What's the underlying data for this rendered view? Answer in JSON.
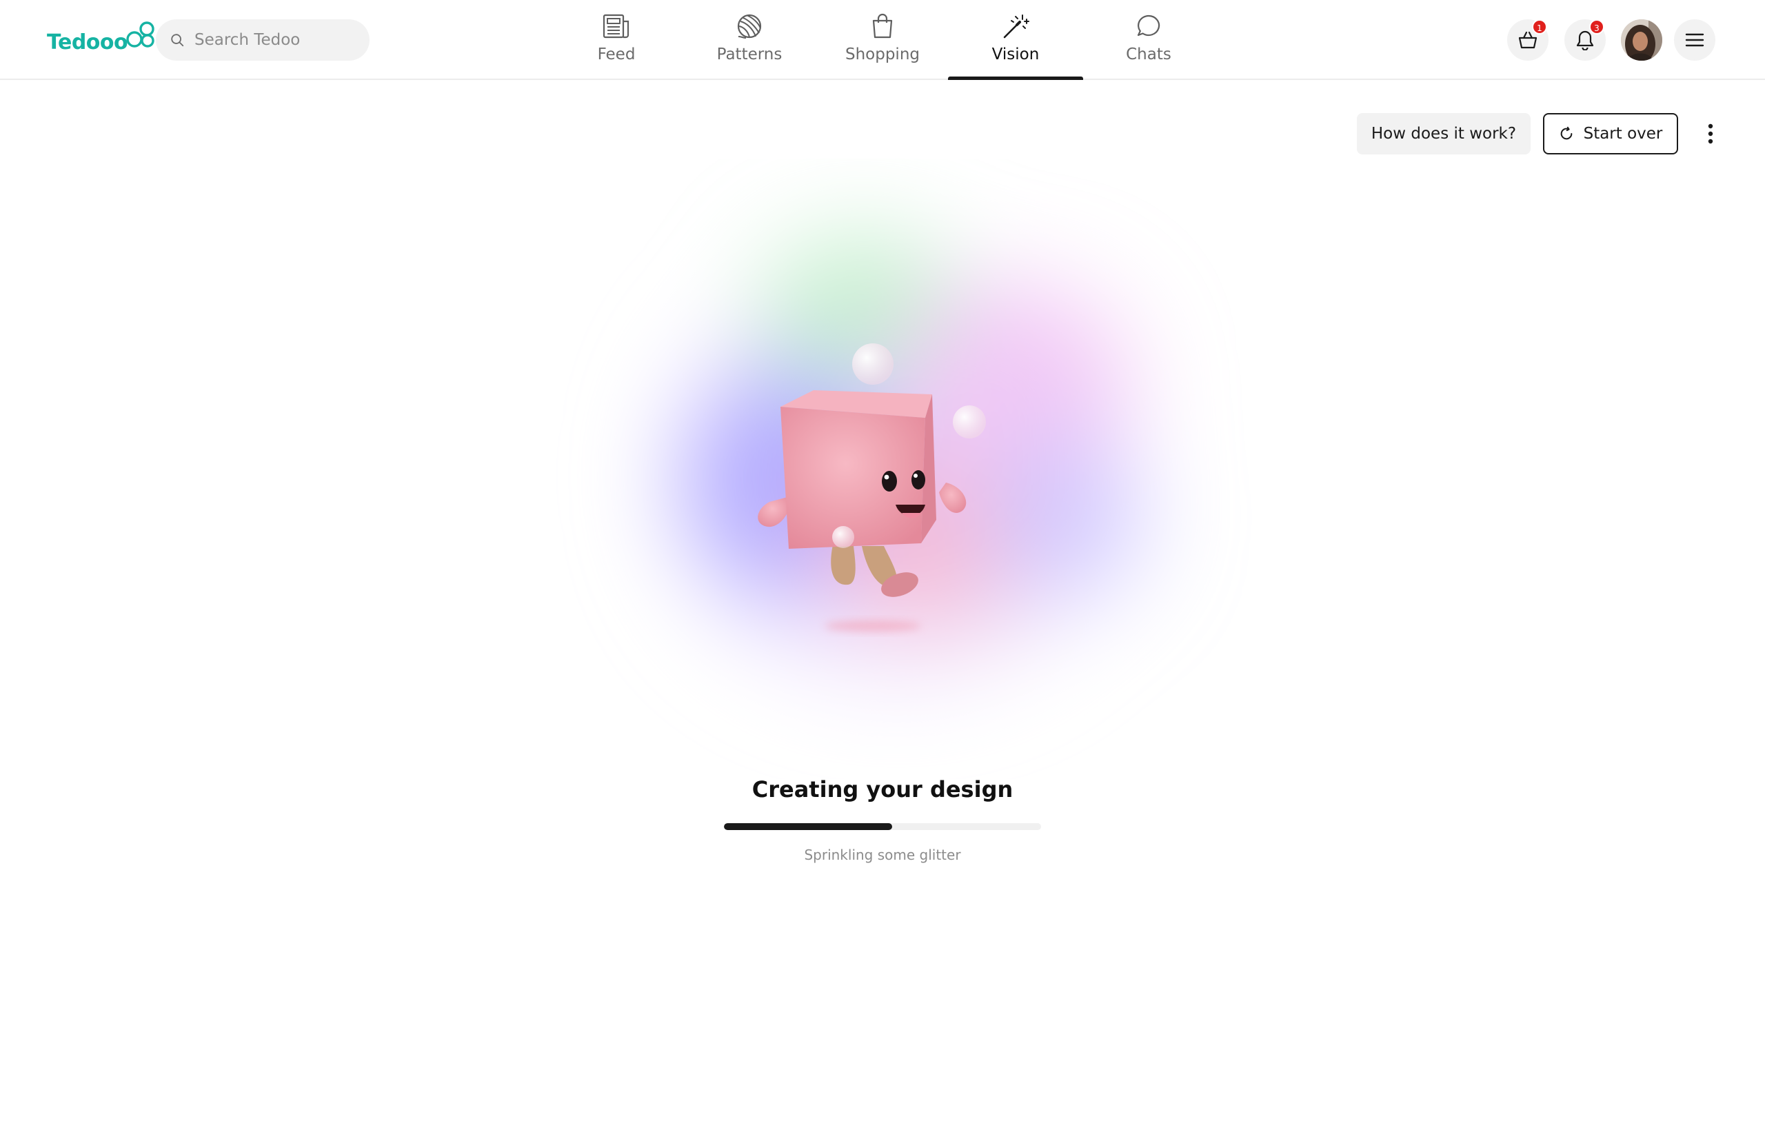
{
  "brand": {
    "logo_text": "Tedooo",
    "accent_color": "#16b3a3"
  },
  "search": {
    "placeholder": "Search Tedoo",
    "value": ""
  },
  "nav": {
    "tabs": [
      {
        "label": "Feed",
        "icon": "newspaper-icon",
        "active": false
      },
      {
        "label": "Patterns",
        "icon": "yarn-ball-icon",
        "active": false
      },
      {
        "label": "Shopping",
        "icon": "shopping-bag-icon",
        "active": false
      },
      {
        "label": "Vision",
        "icon": "magic-wand-icon",
        "active": true
      },
      {
        "label": "Chats",
        "icon": "chat-bubble-icon",
        "active": false
      }
    ]
  },
  "header_actions": {
    "cart_badge": "1",
    "notifications_badge": "3",
    "badge_color": "#e0201c"
  },
  "actions": {
    "how_label": "How does it work?",
    "start_over_label": "Start over"
  },
  "status": {
    "title": "Creating your design",
    "subtitle": "Sprinkling some glitter",
    "progress": 0.53
  }
}
